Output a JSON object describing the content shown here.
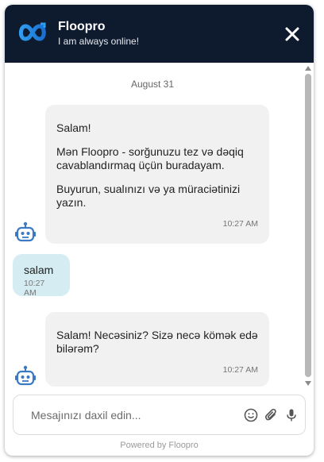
{
  "header": {
    "title": "Floopro",
    "status": "I am always online!",
    "logo_icon": "infinity-logo-icon",
    "close_icon": "close-icon"
  },
  "chat": {
    "date": "August 31",
    "messages": [
      {
        "sender": "bot",
        "paragraphs": [
          "Salam!",
          "Mən Floopro - sorğunuzu tez və dəqiq cavablandırmaq üçün buradayam.",
          "Buyurun, sualınızı və ya müraciətinizi yazın."
        ],
        "time": "10:27 AM"
      },
      {
        "sender": "user",
        "text": "salam",
        "time": "10:27 AM"
      },
      {
        "sender": "bot",
        "paragraphs": [
          "Salam! Necəsiniz? Sizə necə kömək edə bilərəm?"
        ],
        "time": "10:27 AM"
      }
    ]
  },
  "input": {
    "placeholder": "Mesajınızı daxil edin...",
    "value": ""
  },
  "footer": {
    "powered_by": "Powered by Floopro"
  },
  "colors": {
    "header_bg": "#0e1b2f",
    "logo_blue": "#1f8ee6",
    "bot_bubble": "#f1f1f1",
    "user_bubble": "#d4ecf2",
    "avatar_blue": "#3b79c4"
  }
}
